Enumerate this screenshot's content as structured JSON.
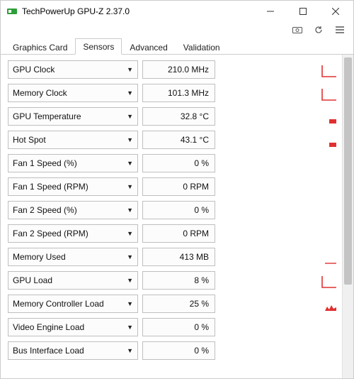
{
  "window": {
    "title": "TechPowerUp GPU-Z 2.37.0"
  },
  "tabs": {
    "graphics_card": "Graphics Card",
    "sensors": "Sensors",
    "advanced": "Advanced",
    "validation": "Validation",
    "active_index": 1
  },
  "sensors": [
    {
      "label": "GPU Clock",
      "value": "210.0 MHz",
      "spark": "step"
    },
    {
      "label": "Memory Clock",
      "value": "101.3 MHz",
      "spark": "step"
    },
    {
      "label": "GPU Temperature",
      "value": "32.8 °C",
      "spark": "bar"
    },
    {
      "label": "Hot Spot",
      "value": "43.1 °C",
      "spark": "bar"
    },
    {
      "label": "Fan 1 Speed (%)",
      "value": "0 %",
      "spark": "none"
    },
    {
      "label": "Fan 1 Speed (RPM)",
      "value": "0 RPM",
      "spark": "none"
    },
    {
      "label": "Fan 2 Speed (%)",
      "value": "0 %",
      "spark": "none"
    },
    {
      "label": "Fan 2 Speed (RPM)",
      "value": "0 RPM",
      "spark": "none"
    },
    {
      "label": "Memory Used",
      "value": "413 MB",
      "spark": "line-low"
    },
    {
      "label": "GPU Load",
      "value": "8 %",
      "spark": "step"
    },
    {
      "label": "Memory Controller Load",
      "value": "25 %",
      "spark": "area"
    },
    {
      "label": "Video Engine Load",
      "value": "0 %",
      "spark": "none"
    },
    {
      "label": "Bus Interface Load",
      "value": "0 %",
      "spark": "none"
    }
  ]
}
